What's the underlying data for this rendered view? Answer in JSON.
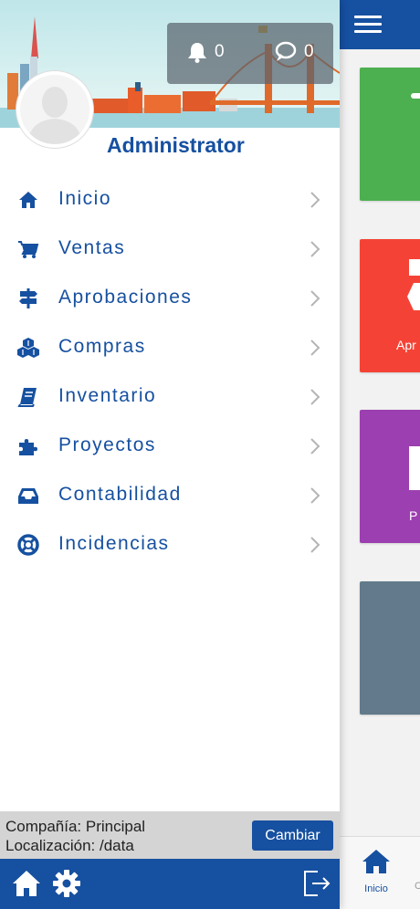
{
  "main": {
    "tiles": [
      {
        "label": "",
        "color": "#4caf50"
      },
      {
        "label": "Apr",
        "color": "#f44336"
      },
      {
        "label": "P",
        "color": "#9c3fb0"
      },
      {
        "label": "",
        "color": "#627a8b"
      }
    ],
    "tabbar": {
      "active_label": "Inicio",
      "next_label": "C"
    }
  },
  "drawer": {
    "notifications": {
      "bell_count": "0",
      "chat_count": "0"
    },
    "username": "Administrator",
    "menu": [
      {
        "label": "Inicio",
        "icon": "home-icon"
      },
      {
        "label": "Ventas",
        "icon": "cart-icon"
      },
      {
        "label": "Aprobaciones",
        "icon": "signpost-icon"
      },
      {
        "label": "Compras",
        "icon": "cubes-icon"
      },
      {
        "label": "Inventario",
        "icon": "book-icon"
      },
      {
        "label": "Proyectos",
        "icon": "puzzle-icon"
      },
      {
        "label": "Contabilidad",
        "icon": "inbox-icon"
      },
      {
        "label": "Incidencias",
        "icon": "lifebuoy-icon"
      }
    ],
    "company_line": "Compañía: Principal",
    "location_line": "Localización: /data",
    "change_button": "Cambiar"
  },
  "colors": {
    "brand": "#1650a0",
    "company_bar": "#d4d4d4"
  }
}
